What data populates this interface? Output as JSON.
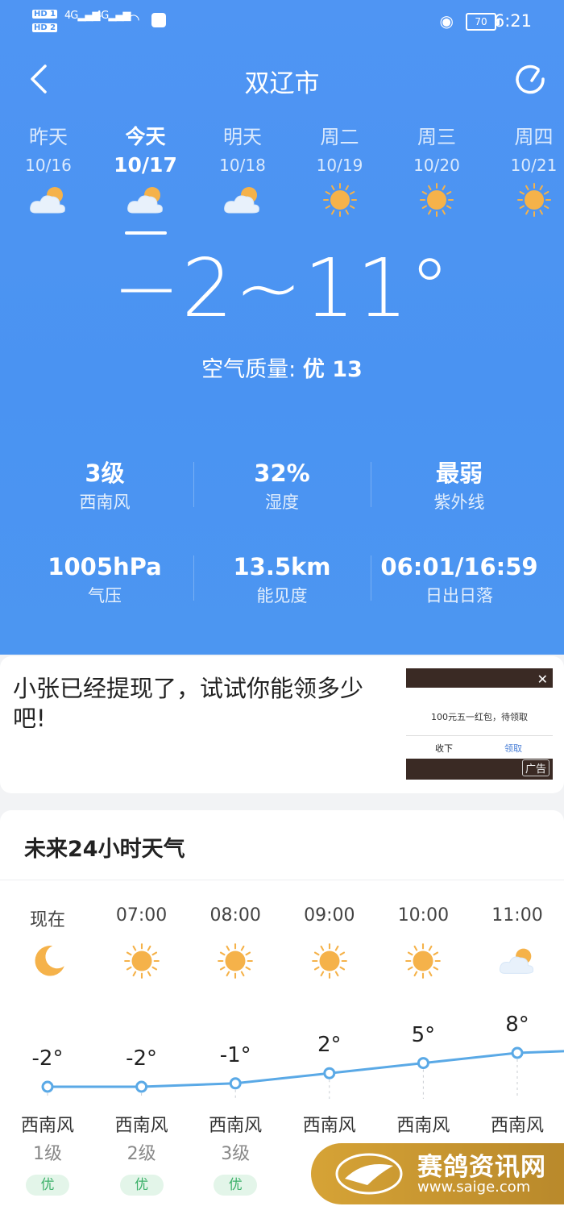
{
  "status": {
    "time": "6:21",
    "battery": "70",
    "sim1": "HD 1",
    "sim2": "HD 2",
    "net1": "4G",
    "net2": "4G"
  },
  "header": {
    "city": "双辽市"
  },
  "days": [
    {
      "name": "昨天",
      "date": "10/16",
      "icon": "partly-cloudy-icon"
    },
    {
      "name": "今天",
      "date": "10/17",
      "icon": "partly-cloudy-icon",
      "active": true
    },
    {
      "name": "明天",
      "date": "10/18",
      "icon": "partly-cloudy-icon"
    },
    {
      "name": "周二",
      "date": "10/19",
      "icon": "sun-icon"
    },
    {
      "name": "周三",
      "date": "10/20",
      "icon": "sun-icon"
    },
    {
      "name": "周四",
      "date": "10/21",
      "icon": "sun-icon"
    }
  ],
  "current": {
    "temp_range": "−2~11°",
    "aqi_label": "空气质量:",
    "aqi_value": "优 13"
  },
  "stats": [
    {
      "value": "3级",
      "label": "西南风"
    },
    {
      "value": "32%",
      "label": "湿度"
    },
    {
      "value": "最弱",
      "label": "紫外线"
    },
    {
      "value": "1005hPa",
      "label": "气压"
    },
    {
      "value": "13.5km",
      "label": "能见度"
    },
    {
      "value": "06:01/16:59",
      "label": "日出日落"
    }
  ],
  "ad": {
    "text": "小张已经提现了，试试你能领多少吧!",
    "popup_text": "100元五一红包，待领取",
    "popup_cancel": "收下",
    "popup_ok": "领取",
    "label": "广告"
  },
  "hourly": {
    "title": "未来24小时天气",
    "hours": [
      {
        "time": "现在",
        "icon": "moon-icon",
        "temp": "-2°",
        "wind": "西南风",
        "level": "1级",
        "aq": "优"
      },
      {
        "time": "07:00",
        "icon": "sun-icon",
        "temp": "-2°",
        "wind": "西南风",
        "level": "2级",
        "aq": "优"
      },
      {
        "time": "08:00",
        "icon": "sun-icon",
        "temp": "-1°",
        "wind": "西南风",
        "level": "3级",
        "aq": "优"
      },
      {
        "time": "09:00",
        "icon": "sun-icon",
        "temp": "2°",
        "wind": "西南风",
        "level": "",
        "aq": ""
      },
      {
        "time": "10:00",
        "icon": "sun-icon",
        "temp": "5°",
        "wind": "西南风",
        "level": "",
        "aq": ""
      },
      {
        "time": "11:00",
        "icon": "partly-cloudy-icon",
        "temp": "8°",
        "wind": "西南风",
        "level": "",
        "aq": ""
      }
    ],
    "temp_values": [
      -2,
      -2,
      -1,
      2,
      5,
      8,
      9
    ]
  },
  "watermark": {
    "name": "赛鸽资讯网",
    "url": "www.saige.com"
  },
  "colors": {
    "sky": "#4a93f2",
    "sun": "#f5b24a",
    "curve": "#5aa9e6",
    "aq_good": "#3db16a"
  }
}
